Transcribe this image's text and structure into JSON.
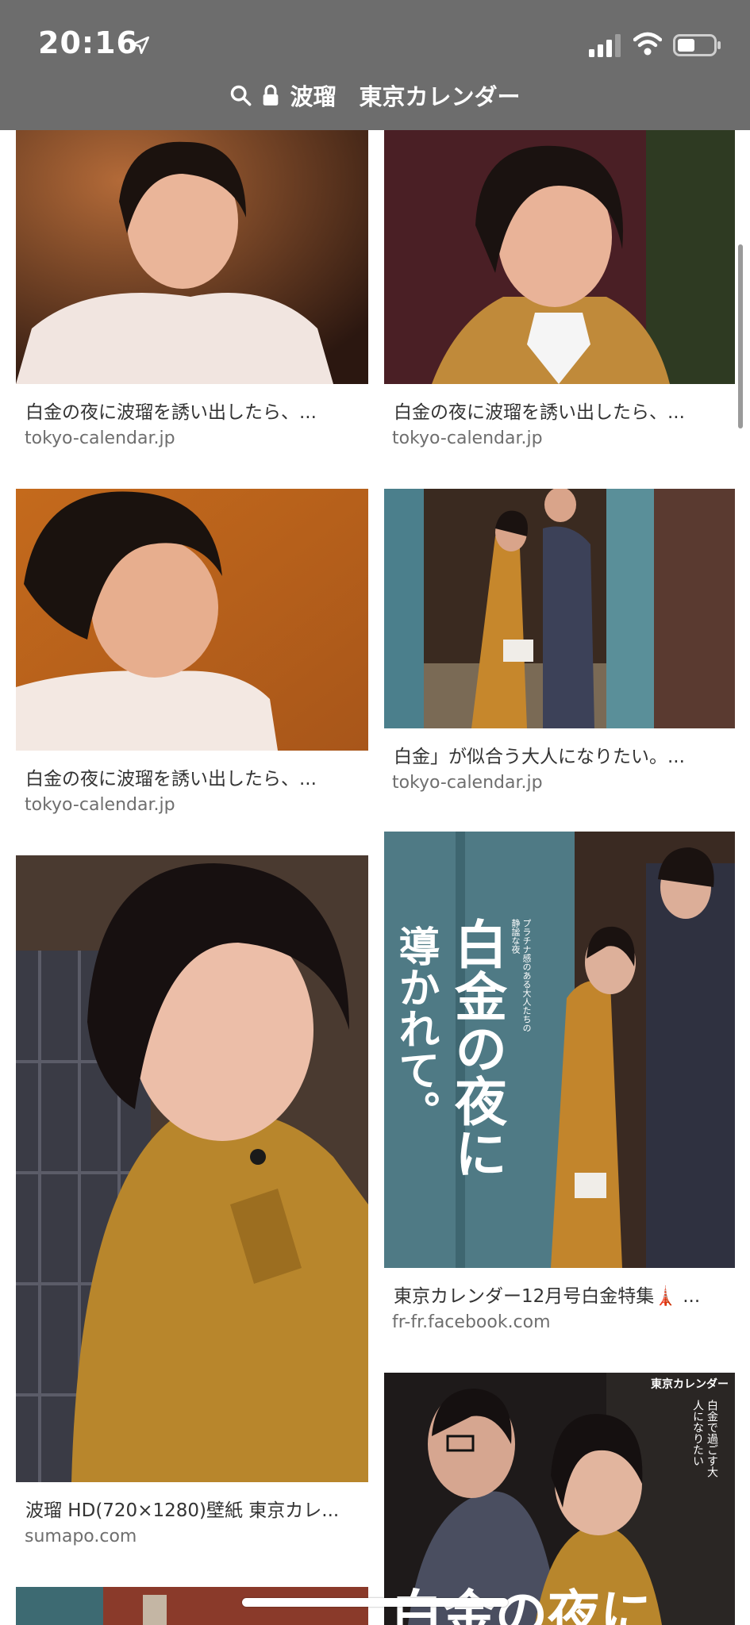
{
  "status_bar": {
    "time": "20:16"
  },
  "address_bar": {
    "query": "波瑠　東京カレンダー"
  },
  "results": [
    {
      "caption": "白金の夜に波瑠を誘い出したら、...",
      "domain": "tokyo-calendar.jp"
    },
    {
      "caption": "白金の夜に波瑠を誘い出したら、...",
      "domain": "tokyo-calendar.jp"
    },
    {
      "caption": "白金の夜に波瑠を誘い出したら、...",
      "domain": "tokyo-calendar.jp"
    },
    {
      "caption": "白金」が似合う大人になりたい。...",
      "domain": "tokyo-calendar.jp"
    },
    {
      "caption": "波瑠 HD(720×1280)壁紙 東京カレ...",
      "domain": "sumapo.com"
    },
    {
      "caption": "東京カレンダー12月号白金特集🗼 ...",
      "domain": "fr-fr.facebook.com"
    }
  ],
  "image_text": {
    "magazine_big": "白金の夜に",
    "magazine_left": "導かれて。",
    "magazine_small": "プラチナ感のある大人たちの静謐な夜",
    "magazine2_brand": "東京カレンダー",
    "magazine2_sub": "白金で過ごす大人になりたい",
    "magazine2_big": "白金の夜に"
  }
}
